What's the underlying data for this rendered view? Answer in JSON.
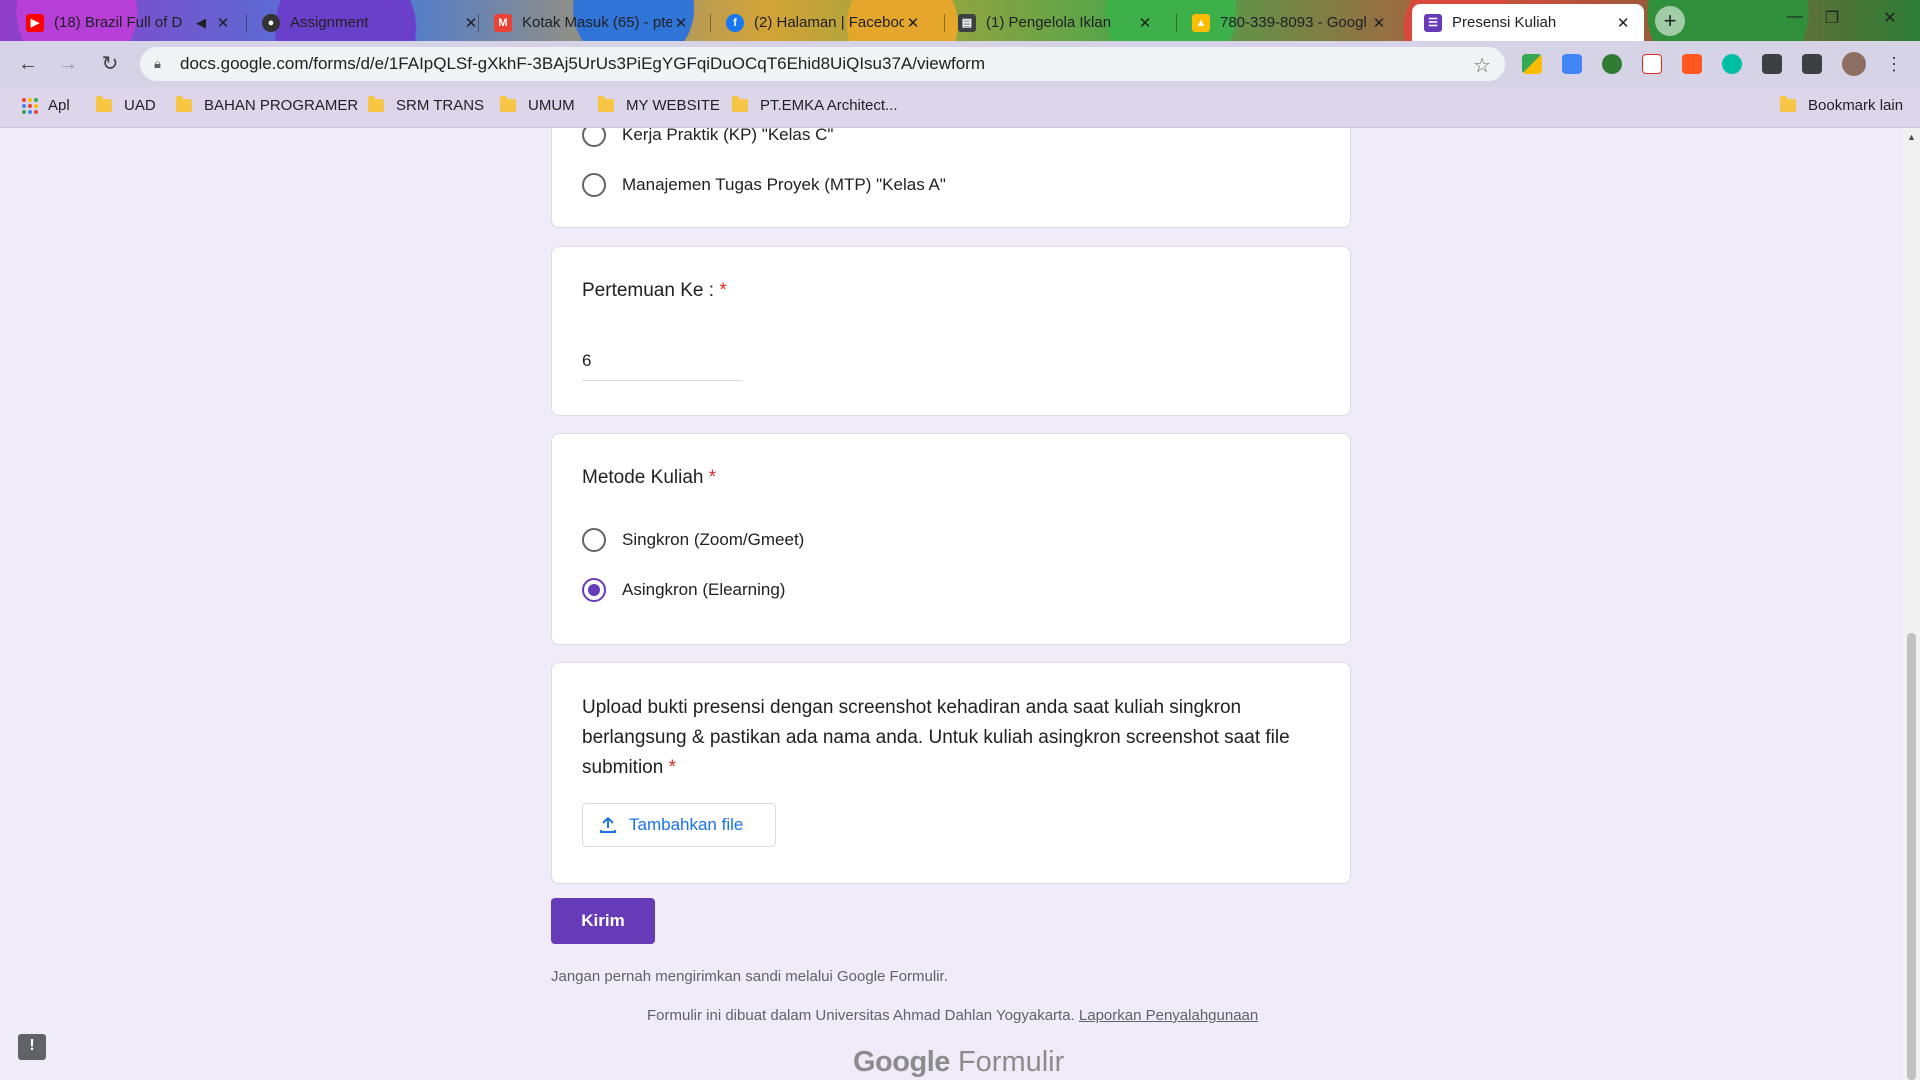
{
  "tabs": [
    {
      "title": "(18) Brazil Full of D",
      "icon": "youtube-icon",
      "color": "#ff0000"
    },
    {
      "title": "Assignment",
      "icon": "github-icon",
      "color": "#333333"
    },
    {
      "title": "Kotak Masuk (65) - pte",
      "icon": "gmail-icon",
      "color": "#ea4335"
    },
    {
      "title": "(2) Halaman | Faceboo",
      "icon": "facebook-icon",
      "color": "#1877f2"
    },
    {
      "title": "(1) Pengelola Iklan",
      "icon": "ads-manager-icon",
      "color": "#3c4043"
    },
    {
      "title": "780-339-8093 - Googl",
      "icon": "google-ads-icon",
      "color": "#fbbc04"
    },
    {
      "title": "Presensi Kuliah",
      "icon": "google-forms-icon",
      "color": "#673ab7"
    }
  ],
  "address_bar": {
    "url": "docs.google.com/forms/d/e/1FAIpQLSf-gXkhF-3BAj5UrUs3PiEgYGFqiDuOCqT6Ehid8UiQIsu37A/viewform"
  },
  "bookmarks": {
    "apps": "Apl",
    "items": [
      "UAD",
      "BAHAN PROGRAMER",
      "SRM TRANS",
      "UMUM",
      "MY WEBSITE",
      "PT.EMKA Architect..."
    ],
    "other": "Bookmark lain"
  },
  "form": {
    "course_question": {
      "partial_option": "Kerja Praktik (KP) \"Kelas C\"",
      "last_option": "Manajemen Tugas Proyek (MTP) \"Kelas A\""
    },
    "meeting": {
      "title": "Pertemuan Ke :",
      "required": "*",
      "value": "6"
    },
    "method": {
      "title": "Metode Kuliah",
      "required": "*",
      "options": [
        "Singkron (Zoom/Gmeet)",
        "Asingkron (Elearning)"
      ],
      "selected": "Asingkron (Elearning)"
    },
    "upload": {
      "description": "Upload bukti presensi dengan screenshot kehadiran anda saat kuliah singkron berlangsung & pastikan ada nama anda. Untuk kuliah asingkron screenshot saat file submition",
      "required": "*",
      "button_label": "Tambahkan file"
    },
    "submit_label": "Kirim",
    "password_warning": "Jangan pernah mengirimkan sandi melalui Google Formulir.",
    "created_in": "Formulir ini dibuat dalam Universitas Ahmad Dahlan Yogyakarta.",
    "report_abuse": "Laporkan Penyalahgunaan",
    "brand_google": "Google",
    "brand_forms": "Formulir"
  },
  "colors": {
    "accent": "#673ab7",
    "required": "#d93025",
    "link_blue": "#1a73e8",
    "page_bg": "#f0ebf8"
  }
}
